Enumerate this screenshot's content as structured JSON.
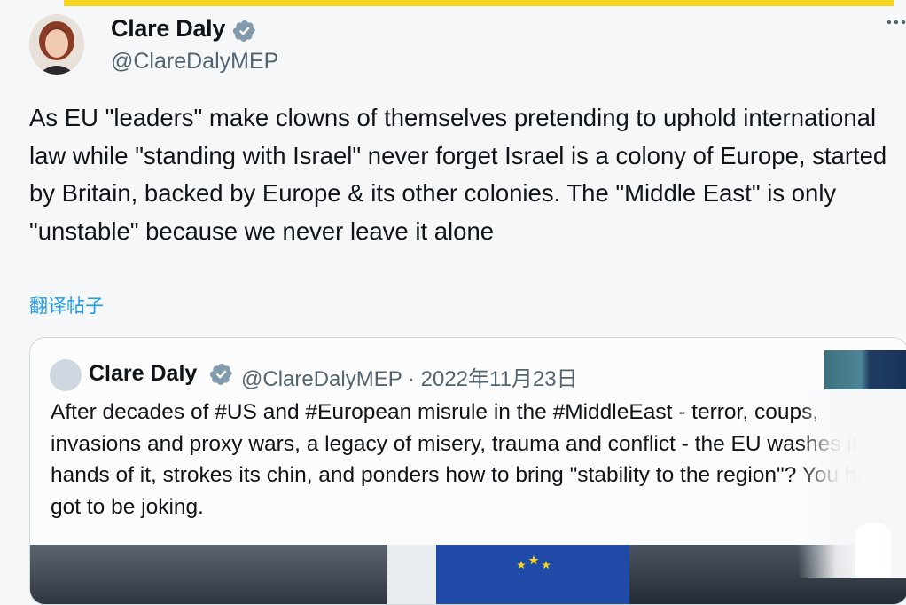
{
  "tweet": {
    "author_name": "Clare Daly",
    "handle": "@ClareDalyMEP",
    "text": "As EU \"leaders\" make clowns of themselves pretending to uphold international law while \"standing with Israel\" never forget Israel is a colony of Europe, started by Britain, backed by Europe & its other colonies. The \"Middle East\" is only \"unstable\" because we never leave it alone",
    "translate_label": "翻译帖子"
  },
  "quoted_tweet": {
    "author_name": "Clare Daly",
    "meta": "@ClareDalyMEP · 2022年11月23日",
    "text": "After decades of #US and #European misrule in the #MiddleEast - terror, coups, invasions and proxy wars, a legacy of misery, trauma and conflict - the EU washes its hands of it, strokes its chin, and ponders how to bring \"stability to the region\"? You have got to be joking."
  },
  "icons": {
    "verified": "verified-badge-icon",
    "more": "more-options-icon"
  },
  "colors": {
    "accent_bar": "#f5d51e",
    "link": "#1d9bf0",
    "secondary_text": "#536471",
    "verified_badge": "#829aab"
  }
}
